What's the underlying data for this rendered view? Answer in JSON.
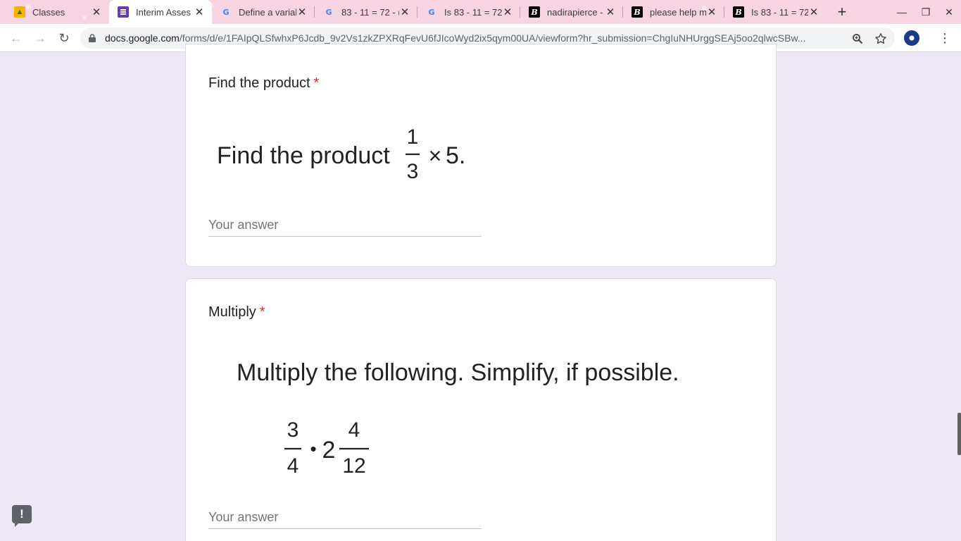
{
  "tabs": [
    {
      "title": "Classes",
      "favicon": "classroom-icon",
      "close": "✕"
    },
    {
      "title": "Interim Asses",
      "favicon": "forms-icon",
      "close": "✕"
    },
    {
      "title": "Define a varial",
      "favicon": "google-icon",
      "close": "✕"
    },
    {
      "title": "83 - 11 = 72 - (",
      "favicon": "google-icon",
      "close": "✕"
    },
    {
      "title": "Is 83 - 11 = 72",
      "favicon": "google-icon",
      "close": "✕"
    },
    {
      "title": "nadirapierce -",
      "favicon": "brainly-icon",
      "close": "✕"
    },
    {
      "title": "please help m",
      "favicon": "brainly-icon",
      "close": "✕"
    },
    {
      "title": "Is 83 - 11 = 72",
      "favicon": "brainly-icon",
      "close": "✕"
    }
  ],
  "favicon_glyphs": {
    "google": "G",
    "brainly": "B"
  },
  "toolbar": {
    "new_tab": "+",
    "minimize": "—",
    "maximize": "❐",
    "close": "✕",
    "back": "←",
    "forward": "→",
    "reload": "↻",
    "url_domain": "docs.google.com",
    "url_path": "/forms/d/e/1FAIpQLSfwhxP6Jcdb_9v2Vs1zkZPXRqFevU6fJIcoWyd2ix5qym00UA/viewform?hr_submission=ChgIuNHUrggSEAj5oo2qlwcSBw...",
    "zoom_icon": "zoom-icon",
    "star_icon": "star-icon",
    "menu": "⋮"
  },
  "questions": [
    {
      "title": "Find the product",
      "required_mark": "*",
      "image_text": {
        "prefix": "Find the product",
        "numerator": "1",
        "denominator": "3",
        "operator": "×",
        "factor": "5."
      },
      "answer_placeholder": "Your answer"
    },
    {
      "title": "Multiply",
      "required_mark": "*",
      "image_text": {
        "heading": "Multiply the following. Simplify, if possible.",
        "n1": "3",
        "d1": "4",
        "dot": "•",
        "whole": "2",
        "n2": "4",
        "d2": "12"
      },
      "answer_placeholder": "Your answer"
    }
  ],
  "feedback_label": "!"
}
